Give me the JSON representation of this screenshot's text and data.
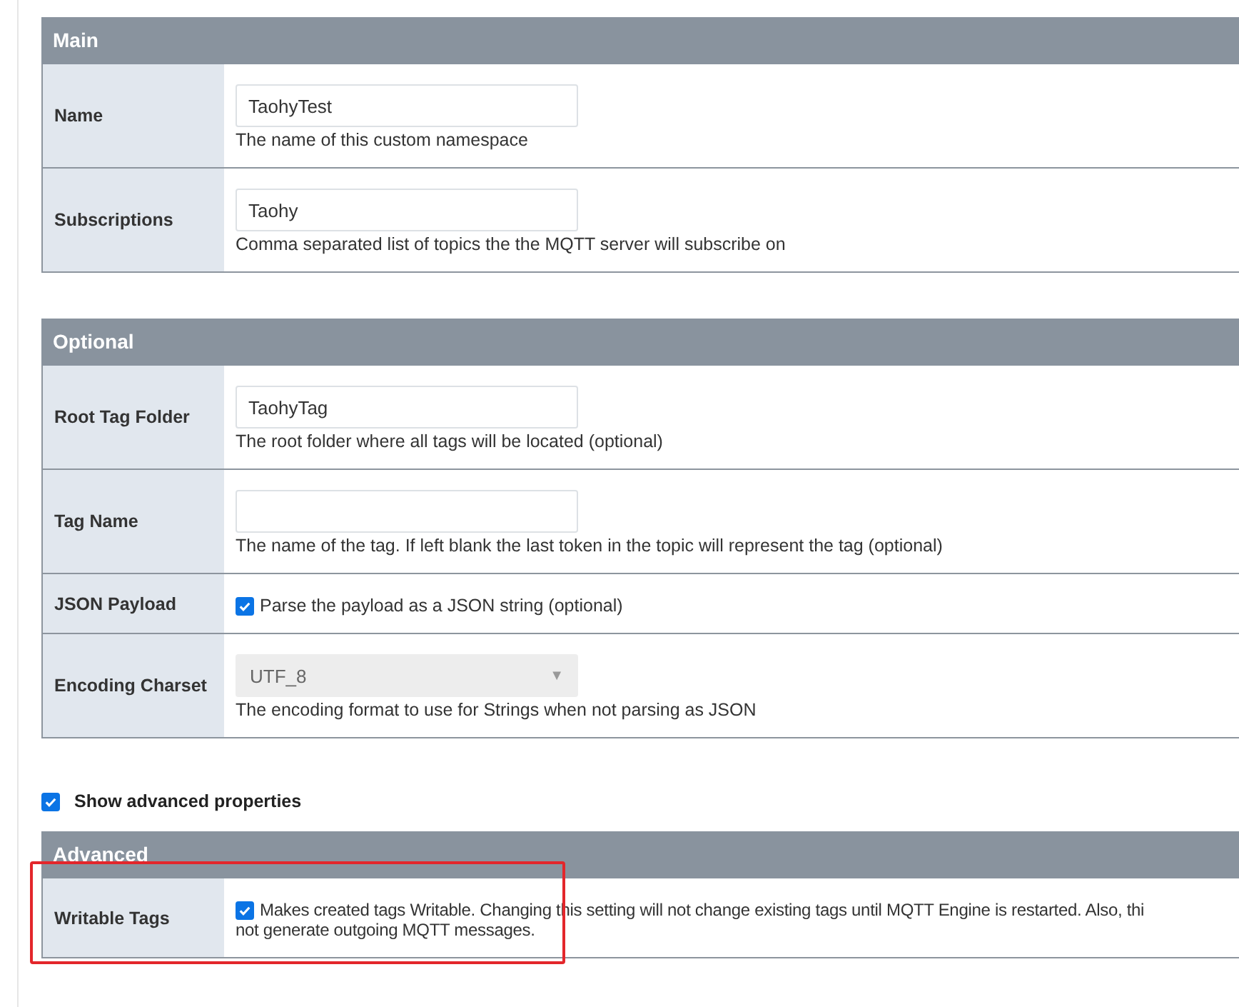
{
  "blocks": [
    {
      "kind": "section",
      "title": "Main",
      "highlighted": false,
      "rows": [
        {
          "label": "Name",
          "kind": "text",
          "value": "TaohyTest",
          "description": "The name of this custom namespace"
        },
        {
          "label": "Subscriptions",
          "kind": "text",
          "value": "Taohy",
          "description": "Comma separated list of topics the the MQTT server will subscribe on"
        }
      ]
    },
    {
      "kind": "section",
      "title": "Optional",
      "highlighted": false,
      "rows": [
        {
          "label": "Root Tag Folder",
          "kind": "text",
          "value": "TaohyTag",
          "description": "The root folder where all tags will be located (optional)"
        },
        {
          "label": "Tag Name",
          "kind": "text",
          "value": "",
          "description": "The name of the tag. If left blank the last token in the topic will represent the tag (optional)"
        },
        {
          "label": "JSON Payload",
          "kind": "checkbox",
          "checked": true,
          "lines": [
            "Parse the payload as a JSON string (optional)"
          ]
        },
        {
          "label": "Encoding Charset",
          "kind": "select",
          "value": "UTF_8",
          "disabled": true,
          "caret": "▼",
          "description": "The encoding format to use for Strings when not parsing as JSON"
        }
      ]
    },
    {
      "kind": "toggle",
      "label": "Show advanced properties",
      "checked": true
    },
    {
      "kind": "section",
      "title": "Advanced",
      "highlighted": true,
      "rows": [
        {
          "label": "Writable Tags",
          "kind": "checkbox",
          "checked": true,
          "lines": [
            "Makes created tags Writable. Changing this setting will not change existing tags until MQTT Engine is restarted. Also, thi",
            "not generate outgoing MQTT messages."
          ]
        }
      ]
    }
  ]
}
